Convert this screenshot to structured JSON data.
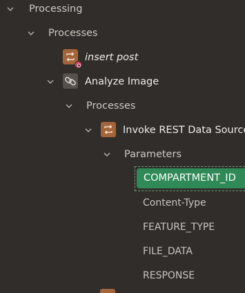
{
  "tree": {
    "processing": {
      "label": "Processing",
      "expanded": true
    },
    "processes": {
      "label": "Processes",
      "expanded": true
    },
    "insert_post": {
      "label": "insert post",
      "icon": "process-icon",
      "status": "error"
    },
    "analyze_image": {
      "label": "Analyze Image",
      "icon": "link-icon",
      "expanded": true
    },
    "analyze_processes": {
      "label": "Processes",
      "expanded": true
    },
    "invoke_rest": {
      "label": "Invoke REST Data Source",
      "icon": "process-icon",
      "expanded": true
    },
    "parameters": {
      "label": "Parameters",
      "expanded": true
    },
    "params": [
      {
        "label": "COMPARTMENT_ID",
        "selected": true
      },
      {
        "label": "Content-Type",
        "selected": false
      },
      {
        "label": "FEATURE_TYPE",
        "selected": false
      },
      {
        "label": "FILE_DATA",
        "selected": false
      },
      {
        "label": "RESPONSE",
        "selected": false
      }
    ]
  },
  "colors": {
    "background": "#312d2a",
    "selected": "#2f8a57",
    "process_icon": "#a3653a",
    "link_icon": "#56514d",
    "error_badge": "#d3486a"
  }
}
